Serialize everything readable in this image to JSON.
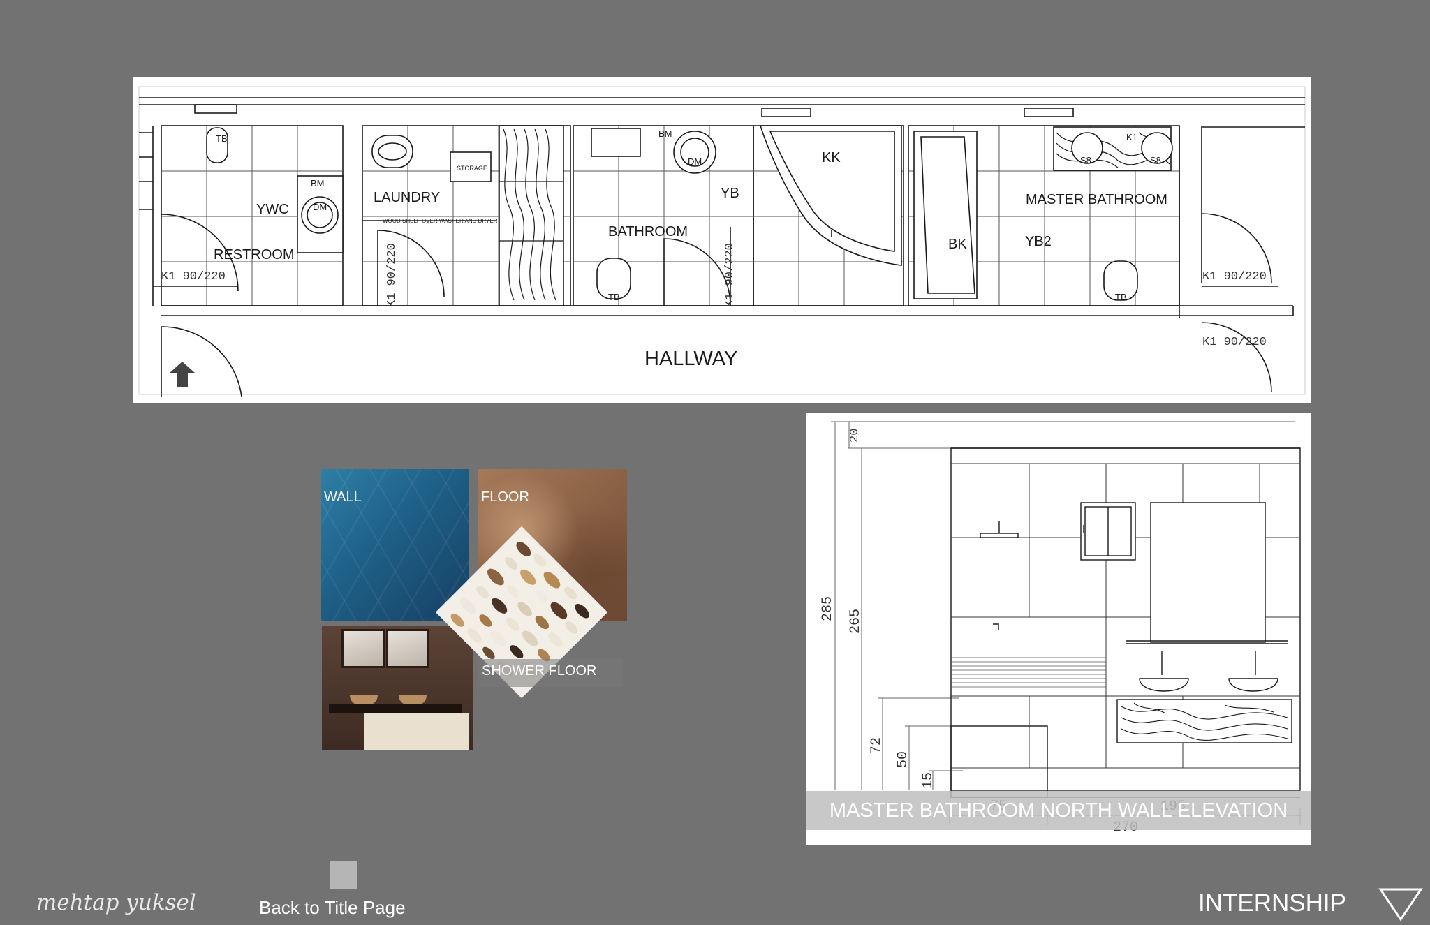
{
  "floor_plan": {
    "rooms": {
      "restroom": "RESTROOM",
      "ywc": "YWC",
      "laundry": "LAUNDRY",
      "storage": "STORAGE",
      "shelf_note": "WOOD SHELF OVER WASHER AND DRYER",
      "bathroom": "BATHROOM",
      "yb": "YB",
      "kk": "KK",
      "master_bathroom": "MASTER BATHROOM",
      "bk": "BK",
      "yb2": "YB2",
      "hallway": "HALLWAY"
    },
    "fixtures": {
      "tb": "TB",
      "bm": "BM",
      "dm": "DM",
      "s8": "S8",
      "k1": "K1"
    },
    "doors": {
      "k1_90_220": "K1 90/220"
    }
  },
  "materials": {
    "wall": "WALL",
    "floor": "FLOOR",
    "shower_floor": "SHOWER FLOOR"
  },
  "elevation": {
    "caption": "MASTER BATHROOM NORTH WALL ELEVATION",
    "dimensions": {
      "d20": "20",
      "d285": "285",
      "d265": "265",
      "d72": "72",
      "d50": "50",
      "d15": "15",
      "d75": "75",
      "d195": "195",
      "d270": "270"
    }
  },
  "footer": {
    "signature": "mehtap yuksel",
    "back_link": "Back to Title Page",
    "section": "INTERNSHIP"
  },
  "colors": {
    "background": "#727272",
    "panel": "#ffffff",
    "ink": "#1a1a1a"
  }
}
